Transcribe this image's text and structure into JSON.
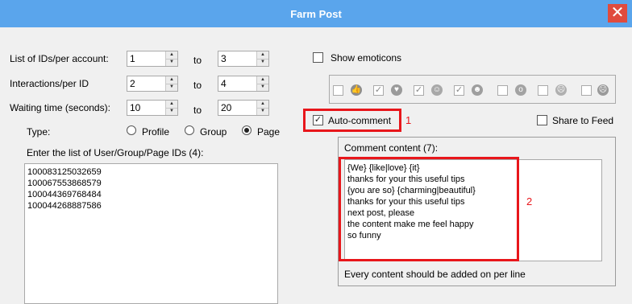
{
  "window": {
    "title": "Farm Post",
    "close_glyph": "✕"
  },
  "settings": {
    "ids_per_account": {
      "label": "List of IDs/per account:",
      "from": "1",
      "to": "3"
    },
    "interactions_per_id": {
      "label": "Interactions/per ID",
      "from": "2",
      "to": "4"
    },
    "waiting_time": {
      "label": "Waiting time (seconds):",
      "from": "10",
      "to": "20"
    },
    "to_label": "to"
  },
  "type": {
    "label": "Type:",
    "options": [
      "Profile",
      "Group",
      "Page"
    ],
    "selected": "Page"
  },
  "id_list": {
    "label": "Enter the list of User/Group/Page IDs (4):",
    "items": [
      "100083125032659",
      "100067553868579",
      "100044369768484",
      "100044268887586"
    ]
  },
  "emoticons": {
    "show_label": "Show emoticons",
    "checked": false,
    "icons": [
      "thumbs-up-icon",
      "heart-icon",
      "laugh-icon",
      "grin-icon",
      "wow-icon",
      "sad-icon",
      "angry-icon"
    ]
  },
  "auto_comment": {
    "label": "Auto-comment",
    "checked": true,
    "marker": "1"
  },
  "share_to_feed": {
    "label": "Share to Feed",
    "checked": false
  },
  "comment": {
    "group_label": "Comment content (7):",
    "lines": [
      "{We} {like|love} {it}",
      "thanks for your this useful tips",
      "{you are so} {charming|beautiful}",
      "thanks for your this useful tips",
      "next post, please",
      "the content make me feel happy",
      "so funny"
    ],
    "marker": "2",
    "hint": "Every content should be added on per line"
  },
  "colors": {
    "titlebar": "#5aa5ec",
    "close": "#e04b3e",
    "highlight": "#e8161b"
  }
}
